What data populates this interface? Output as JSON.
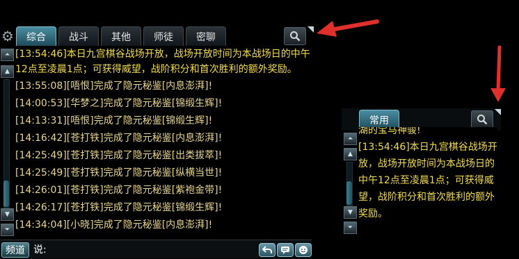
{
  "main_chat": {
    "tabs": [
      "综合",
      "战斗",
      "其他",
      "师徒",
      "密聊"
    ],
    "active_tab": "综合",
    "system_message": "[13:54:46]本日九宫棋谷战场开放，战场开放时间为本战场日的中午12点至凌晨1点；可获得威望，战阶积分和首次胜利的额外奖励。",
    "log_messages": [
      "[13:55:08][唔恨]完成了隐元秘鉴[内息澎湃]!",
      "[14:00:53][华梦之]完成了隐元秘鉴[锦缎生辉]!",
      "[14:13:31][唔恨]完成了隐元秘鉴[锦缎生辉]!",
      "[14:16:42][苍打铁]完成了隐元秘鉴[内息澎湃]!",
      "[14:25:49][苍打铁]完成了隐元秘鉴[出类拔萃]!",
      "[14:25:49][苍打铁]完成了隐元秘鉴[纵横当世]!",
      "[14:26:01][苍打铁]完成了隐元秘鉴[紫袍金带]!",
      "[14:26:17][苍打铁]完成了隐元秘鉴[锦缎生辉]!",
      "[14:34:04][小晓]完成了隐元秘鉴[内息澎湃]!"
    ],
    "input": {
      "channel_label": "频道",
      "prefix": "说:"
    }
  },
  "mini_chat": {
    "tabs": [
      "常用"
    ],
    "partial_line": "湖的宝马神骏!",
    "system_message": "[13:54:46]本日九宫棋谷战场开放，战场开放时间为本战场日的中午12点至凌晨1点；可获得威望，战阶积分和首次胜利的额外奖励。"
  },
  "colors": {
    "system_text": "#f3dc50",
    "log_text": "#e7d58f",
    "arrow": "#e0302b",
    "active_tab": "#3f7f93"
  },
  "icons": [
    "gear-icon",
    "search-icon",
    "scroll-top-icon",
    "scroll-up-icon",
    "scroll-down-icon",
    "scroll-bottom-icon",
    "reply-icon",
    "chat-bubble-icon",
    "emoji-icon",
    "red-arrow"
  ]
}
